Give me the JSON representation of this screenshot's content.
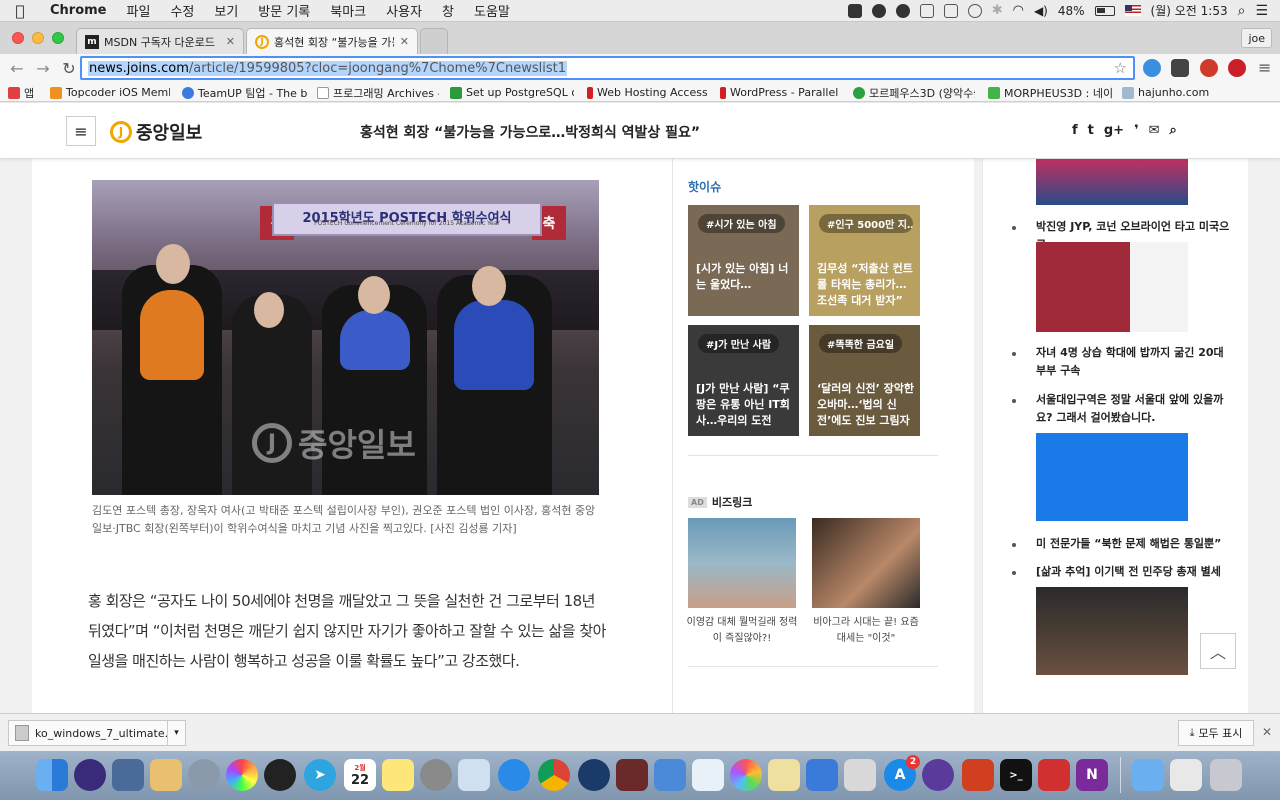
{
  "menubar": {
    "apple": "",
    "app": "Chrome",
    "menus": [
      "파일",
      "수정",
      "보기",
      "방문 기록",
      "북마크",
      "사용자",
      "창",
      "도움말"
    ],
    "battery": "48%",
    "clock": "(월) 오전 1:53"
  },
  "tabs": [
    {
      "favicon": "m",
      "title": "MSDN 구독자 다운로드",
      "active": false
    },
    {
      "favicon": "J",
      "title": "홍석현 회장 “불가능을 가능으로",
      "active": true
    }
  ],
  "user_chip": "joe",
  "omnibox": {
    "host": "news.joins.com",
    "path": "/article/19599805?cloc=joongang%7Chome%7Cnewslist1"
  },
  "bookmarks": [
    {
      "label": "앱",
      "color": "#e04040"
    },
    {
      "label": "Topcoder iOS Memb",
      "color": "#f09020"
    },
    {
      "label": "TeamUP 팀업 - The b",
      "color": "#3b7be0"
    },
    {
      "label": "프로그래밍 Archives -",
      "color": "#cccccc"
    },
    {
      "label": "Set up PostgreSQL o",
      "color": "#2b9a3b"
    },
    {
      "label": "Web Hosting Access",
      "color": "#d02020"
    },
    {
      "label": "WordPress - Parallel",
      "color": "#d02020"
    },
    {
      "label": "모르페우스3D (양악수술",
      "color": "#2aa040"
    },
    {
      "label": "MORPHEUS3D : 네이",
      "color": "#43b548"
    },
    {
      "label": "hajunho.com",
      "color": "#a0b8d0"
    }
  ],
  "site": {
    "logo_text": "중앙일보",
    "logo_letter": "J",
    "headline": "홍석현 회장 “불가능을 가능으로…박정희식 역발상 필요”",
    "social": [
      "f",
      "t",
      "g+",
      "❜",
      "✉",
      "⌕"
    ]
  },
  "article": {
    "photo": {
      "banner": "2015학년도 POSTECH 학위수여식",
      "banner_sub": "POSTECH Commencement Ceremony for 2015 Academic Year",
      "left_sign": "경",
      "right_sign": "축",
      "watermark": "중앙일보",
      "watermark_letter": "J"
    },
    "caption": "김도연 포스텍 총장, 장옥자 여사(고 박태준 포스텍 설립이사장 부인), 권오준 포스텍 법인 이사장, 홍석현 중앙일보·JTBC 회장(왼쪽부터)이 학위수여식을 마치고 기념 사진을 찍고있다. [사진 김성룡 기자]",
    "paragraph": "홍 회장은 “공자도 나이 50세에야 천명을 깨달았고 그 뜻을 실천한 건 그로부터 18년 뒤였다”며 “이처럼 천명은 깨닫기 쉽지 않지만 자기가 좋아하고 잘할 수 있는 삶을 찾아 일생을 매진하는 사람이 행복하고 성공을 이룰 확률도 높다”고 강조했다."
  },
  "hot_issue": {
    "title": "핫이슈",
    "cards": [
      {
        "tag": "#시가 있는 아침",
        "text": "[시가 있는 아침] 너는 울었다…",
        "bg": "#7a6a55"
      },
      {
        "tag": "#인구 5000만 지…",
        "text": "김무성 “저출산 컨트롤 타워는 총리가…조선족 대거 받자”",
        "bg": "#b8a060"
      },
      {
        "tag": "#J가 만난 사람",
        "text": "[J가 만난 사람] “쿠팡은 유통 아닌 IT회사…우리의 도전",
        "bg": "#3a3a3a"
      },
      {
        "tag": "#똑똑한 금요일",
        "text": "‘달러의 신전’ 장악한 오바마…‘법의 신전’에도 진보 그림자",
        "bg": "#6a5a3e"
      }
    ]
  },
  "biz": {
    "ad_label": "AD",
    "title": "비즈링크",
    "ads": [
      {
        "caption": "이영감 대체 뭘먹길래 정력이 즉질않아?!"
      },
      {
        "caption": "비아그라 시대는 끝! 요즘 대세는 \"이것\""
      }
    ]
  },
  "right_news": [
    "박진영 JYP, 코넌 오브라이언 타고 미국으로",
    "자녀 4명 상습 학대에 밥까지 굶긴 20대 부부 구속",
    "서울대입구역은 정말 서울대 앞에 있을까요? 그래서 걸어봤습니다.",
    "미 전문가들 “북한 문제 해법은 통일뿐”",
    "[삶과 추억] 이기택 전 민주당 총재 별세"
  ],
  "scroll_top": "︿",
  "shelf": {
    "file": "ko_windows_7_ultimate....iso",
    "show_all": "모두 표시",
    "close": "✕"
  },
  "dock": {
    "calendar_day": "22",
    "calendar_month": "2월",
    "appstore_badge": "2"
  }
}
